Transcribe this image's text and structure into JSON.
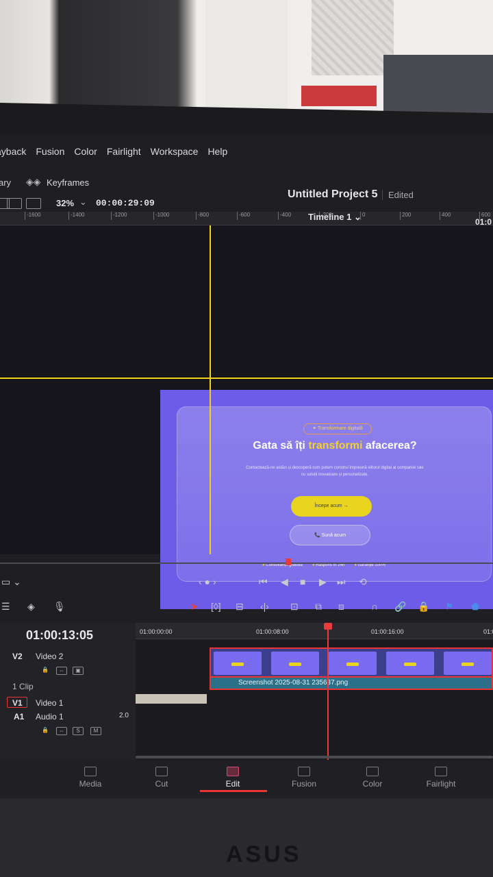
{
  "menubar": {
    "items": [
      "ayback",
      "Fusion",
      "Color",
      "Fairlight",
      "Workspace",
      "Help"
    ]
  },
  "secondbar": {
    "library_tab": "ary",
    "keyframes_label": "Keyframes",
    "project_title": "Untitled Project 5",
    "project_status": "Edited"
  },
  "viewerbar": {
    "zoom": "32%",
    "timecode": "00:00:29:09",
    "timeline_name": "Timeline 1",
    "timecode_right": "01:0"
  },
  "ruler": {
    "ticks": [
      "-1600",
      "-1400",
      "-1200",
      "-1000",
      "-800",
      "-600",
      "-400",
      "-200",
      "0",
      "200",
      "400",
      "600"
    ]
  },
  "canvas": {
    "badge": "✦ Transformare digitală",
    "headline_start": "Gata să îți ",
    "headline_highlight": "transformi",
    "headline_end": " afacerea?",
    "subtext": "Contactează-ne astăzi și descoperă cum putem construi împreună viitorul digital al companiei tale cu soluții inovatoare și personalizate.",
    "cta_primary": "Începe acum →",
    "cta_secondary": "📞 Sună acum",
    "features": [
      "Consultanță gratuită",
      "Răspuns în 24h",
      "Garanție 100%"
    ]
  },
  "timeline": {
    "timecode": "01:00:13:05",
    "ruler_timecodes": [
      "01:00:00:00",
      "01:00:08:00",
      "01:00:16:00",
      "01:0"
    ],
    "tracks": {
      "v2_label": "V2",
      "v2_name": "Video 2",
      "clip_count": "1 Clip",
      "v1_label": "V1",
      "v1_name": "Video 1",
      "a1_label": "A1",
      "a1_name": "Audio 1",
      "a1_channels": "2.0",
      "solo": "S",
      "mute": "M"
    },
    "clip_name": "Screenshot 2025-08-31 235637.png"
  },
  "pages": [
    "Media",
    "Cut",
    "Edit",
    "Fusion",
    "Color",
    "Fairlight"
  ],
  "laptop_brand": "ASUS"
}
